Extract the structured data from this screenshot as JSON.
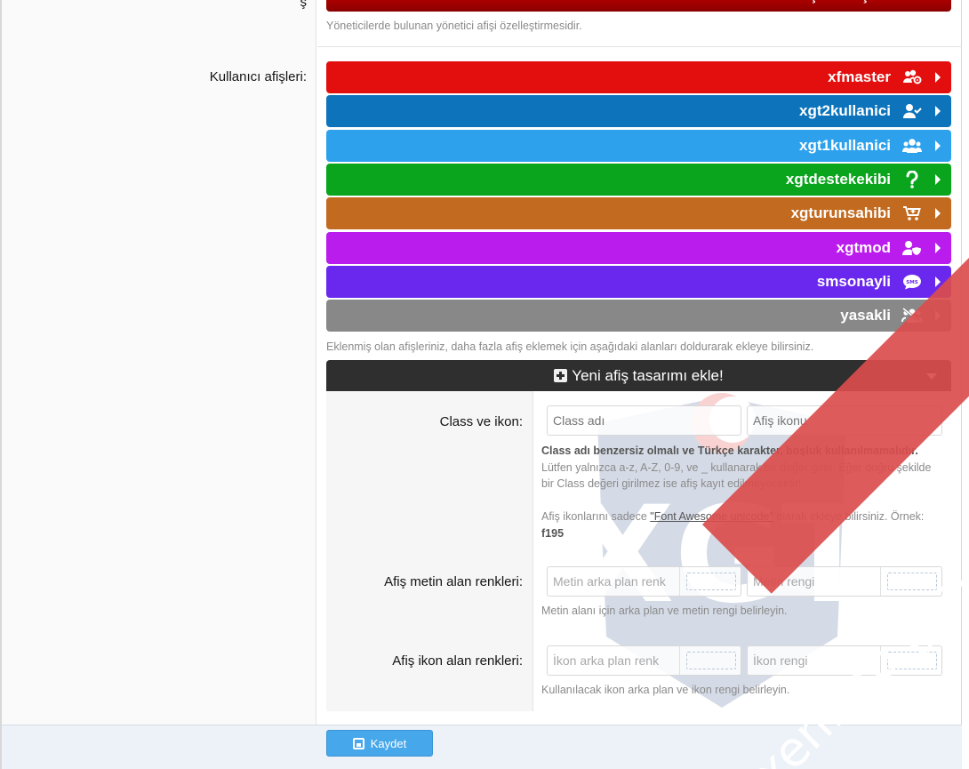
{
  "top": {
    "banner_text": "Yönetici afiş özelleştirmesi",
    "hint": "Yöneticilerde bulunan yönetici afişi özelleştirmesidir."
  },
  "user_banners": {
    "label": "Kullanıcı afişleri:",
    "items": [
      {
        "name": "xfmaster",
        "color": "#e30e0e",
        "icon": "users-cog-icon"
      },
      {
        "name": "xgt2kullanici",
        "color": "#0d74bc",
        "icon": "user-check-icon"
      },
      {
        "name": "xgt1kullanici",
        "color": "#2ea1ed",
        "icon": "users-icon"
      },
      {
        "name": "xgtdestekekibi",
        "color": "#0aa51c",
        "icon": "question-icon"
      },
      {
        "name": "xgturunsahibi",
        "color": "#c26a1f",
        "icon": "cart-plus-icon"
      },
      {
        "name": "xgtmod",
        "color": "#bb1cee",
        "icon": "user-shield-icon"
      },
      {
        "name": "smsonayli",
        "color": "#6a28ee",
        "icon": "sms-icon"
      },
      {
        "name": "yasakli",
        "color": "#888888",
        "icon": "users-slash-icon"
      }
    ],
    "hint": "Eklenmiş olan afişleriniz, daha fazla afiş eklemek için aşağıdaki alanları doldurarak ekleye bilirsiniz."
  },
  "new_banner": {
    "header": "Yeni afiş tasarımı ekle!",
    "class_icon": {
      "label": "Class ve ikon:",
      "class_placeholder": "Class adı",
      "icon_placeholder": "Afiş ikonu",
      "explain_bold": "Class adı benzersiz olmalı ve Türkçe karakter, boşluk kullanılmamalıdır.",
      "explain_1": "Lütfen yalnızca a-z, A-Z, 0-9, ve _ kullanarak bir değer girin. Eğer doğru şekilde bir Class değeri girilmez ise afiş kayıt edilmeyecektir!",
      "explain_2_pre": "Afiş ikonlarını sadece",
      "explain_2_link": "\"Font Awesome unicode\"",
      "explain_2_post": "olarak ekleye bilirsiniz. Örnek:",
      "explain_2_example": "f195"
    },
    "text_colors": {
      "label": "Afiş metin alan renkleri:",
      "bg_placeholder": "Metin arka plan renk",
      "fg_placeholder": "Metin rengi",
      "explain": "Metin alanı için arka plan ve metin rengi belirleyin."
    },
    "icon_colors": {
      "label": "Afiş ikon alan renkleri:",
      "bg_placeholder": "İkon arka plan renk",
      "fg_placeholder": "İkon rengi",
      "explain": "Kullanılacak ikon arka plan ve ikon rengi belirleyin."
    }
  },
  "footer": {
    "save_label": "Kaydet"
  },
  "watermark": {
    "text": "xenforo.gen.tr",
    "logo_text": "XenForo.gen.Tr"
  }
}
